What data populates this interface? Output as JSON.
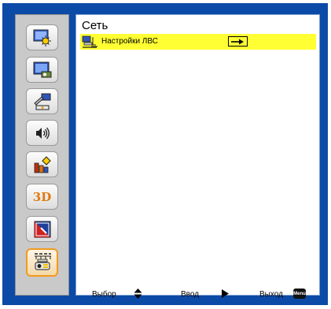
{
  "sidebar": {
    "items": [
      {
        "name": "image-settings",
        "icon": "image-sun-icon"
      },
      {
        "name": "display-settings",
        "icon": "projector-screen-icon"
      },
      {
        "name": "setup",
        "icon": "tools-icon"
      },
      {
        "name": "volume",
        "icon": "speaker-volume-icon"
      },
      {
        "name": "options",
        "icon": "options-chart-icon"
      },
      {
        "name": "3d-settings",
        "label": "3D",
        "icon": "3d-icon"
      },
      {
        "name": "interactive",
        "icon": "interactive-board-icon"
      },
      {
        "name": "network",
        "icon": "network-icon",
        "active": true
      }
    ]
  },
  "main": {
    "title": "Сеть",
    "items": [
      {
        "label": "Настройки ЛВС",
        "selected": true,
        "icon": "lan-computer-icon",
        "action_icon": "enter-arrow-icon"
      }
    ]
  },
  "footer": {
    "select_label": "Выбор",
    "select_icon": "up-down-triangle-icon",
    "enter_label": "Ввод",
    "enter_icon": "right-triangle-icon",
    "exit_label": "Выход",
    "menu_key": "Menu"
  },
  "colors": {
    "frame_blue": "#0b4aa6",
    "highlight": "#ffff33",
    "active_border": "#f29a1f",
    "sidebar_bg": "#c9c9c9"
  }
}
